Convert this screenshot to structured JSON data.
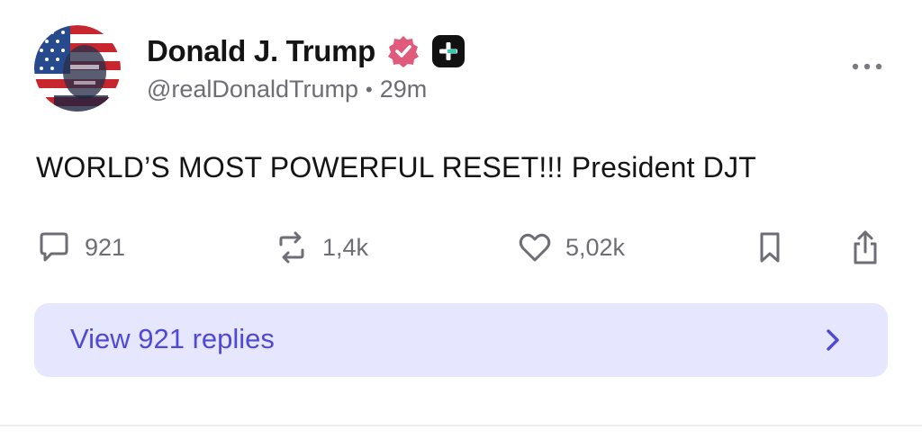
{
  "author": {
    "display_name": "Donald J. Trump",
    "handle": "@realDonaldTrump",
    "separator": "•",
    "timestamp": "29m",
    "verified_badge_color": "#e05a7c",
    "avatar_icon": "avatar-flag-portrait"
  },
  "post": {
    "text": "WORLD’S MOST POWERFUL RESET!!! President DJT"
  },
  "actions": {
    "reply_count": "921",
    "retruth_count": "1,4k",
    "like_count": "5,02k"
  },
  "replies": {
    "view_label": "View 921 replies",
    "background_color": "#e7e6ff",
    "accent_color": "#4f49d8"
  },
  "icons": {
    "verified": "verified-badge-icon",
    "plus": "plus-badge-icon",
    "more": "more-dots-icon",
    "reply": "comment-bubble-icon",
    "retruth": "repost-icon",
    "like": "heart-icon",
    "bookmark": "bookmark-icon",
    "share": "share-icon",
    "chevron": "chevron-right-icon"
  }
}
